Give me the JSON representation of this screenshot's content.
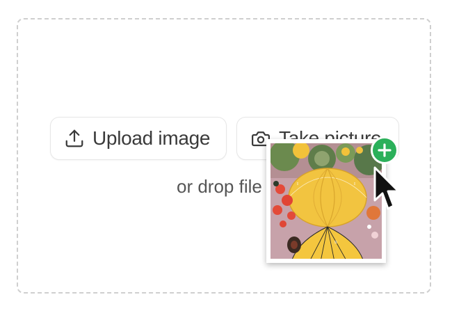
{
  "dropzone": {
    "upload_button_label": "Upload image",
    "upload_icon": "upload-icon",
    "camera_button_label": "Take picture",
    "camera_icon": "camera-icon",
    "drop_hint": "or drop file"
  },
  "drag_preview": {
    "thumbnail_icon": "painting-thumbnail",
    "badge_icon": "plus-icon",
    "badge_color": "#2bb05a",
    "cursor_icon": "arrow-cursor-icon"
  },
  "colors": {
    "border": "#cfcfcf",
    "text": "#3a3a3a"
  }
}
